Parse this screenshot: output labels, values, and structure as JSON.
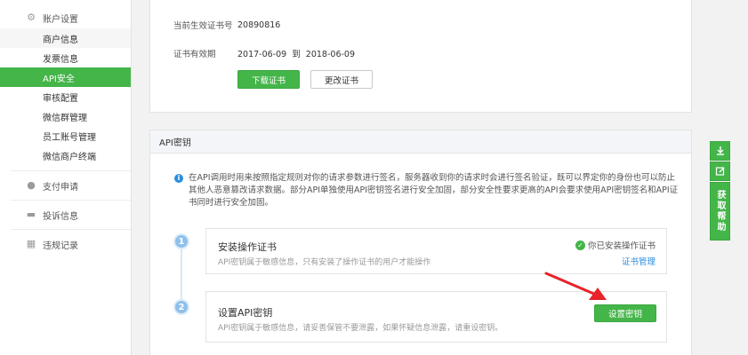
{
  "sidebar": {
    "groups": [
      {
        "label": "账户设置",
        "icon": "gear-icon",
        "items": [
          {
            "label": "商户信息"
          },
          {
            "label": "发票信息"
          },
          {
            "label": "API安全"
          },
          {
            "label": "审核配置"
          },
          {
            "label": "微信群管理"
          },
          {
            "label": "员工账号管理"
          },
          {
            "label": "微信商户终端"
          }
        ]
      },
      {
        "label": "支付申请",
        "icon": "payment-icon"
      },
      {
        "label": "投诉信息",
        "icon": "complaint-icon"
      },
      {
        "label": "违规记录",
        "icon": "grid-icon"
      }
    ]
  },
  "certificate": {
    "serial_label": "当前生效证书号",
    "serial_value": "20890816",
    "validity_label": "证书有效期",
    "validity_value": "2017-06-09  到  2018-06-09",
    "download_button": "下载证书",
    "change_button": "更改证书"
  },
  "api_key": {
    "section_title": "API密钥",
    "notice": "在API调用时用来按照指定规则对你的请求参数进行签名，服务器收到你的请求时会进行签名验证，既可以界定你的身份也可以防止其他人恶意篡改请求数据。部分API单独使用API密钥签名进行安全加固，部分安全性要求更高的API会要求使用API密钥签名和API证书同时进行安全加固。",
    "steps": [
      {
        "number": "1",
        "title": "安装操作证书",
        "desc": "API密钥属于敏感信息，只有安装了操作证书的用户才能操作",
        "status": "你已安装操作证书",
        "link": "证书管理"
      },
      {
        "number": "2",
        "title": "设置API密钥",
        "desc": "API密钥属于敏感信息，请妥善保管不要泄露，如果怀疑信息泄露，请重设密钥。",
        "button": "设置密钥"
      }
    ]
  },
  "help": {
    "label": "获取帮助"
  },
  "colors": {
    "accent": "#44b549",
    "link": "#2c8ee0",
    "arrow": "#e8232a"
  }
}
